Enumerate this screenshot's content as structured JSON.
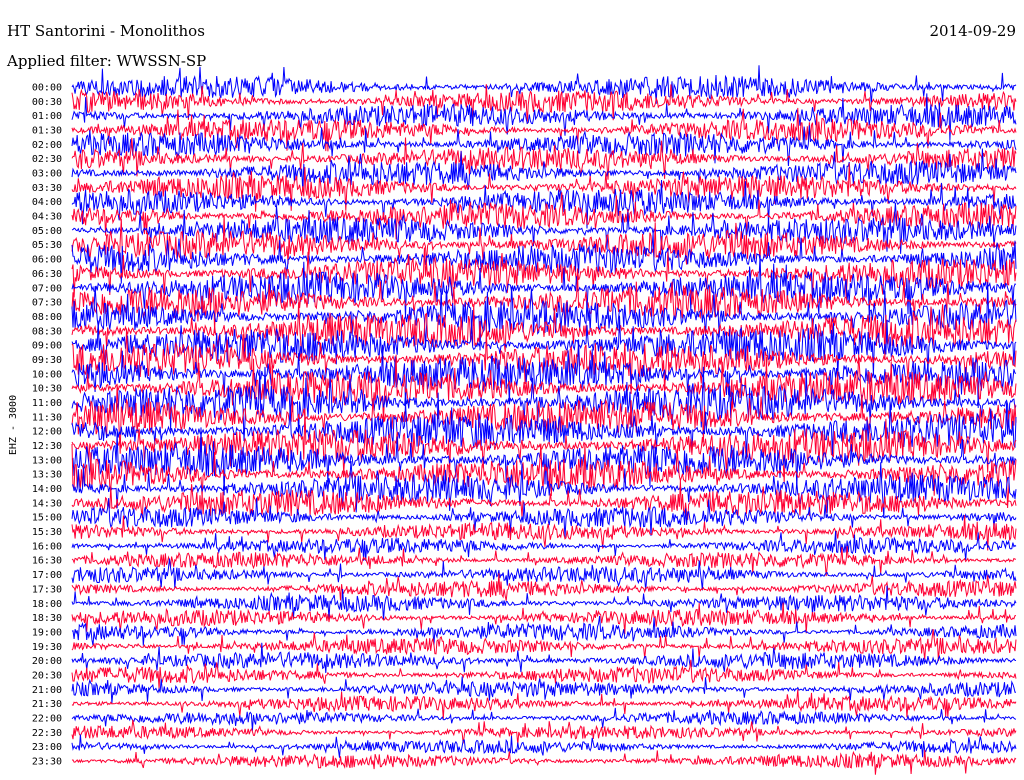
{
  "header": {
    "station_title": "HT Santorini - Monolithos",
    "date": "2014-09-29",
    "filter_text": "Applied filter: WWSSN-SP"
  },
  "chart_data": {
    "type": "helicorder",
    "title": "HT Santorini - Monolithos",
    "date": "2014-09-29",
    "filter": "WWSSN-SP",
    "ylabel": "EHZ - 3000",
    "trace_interval_minutes": 30,
    "trace_colors": [
      "#0000ff",
      "#ff0033"
    ],
    "tick_labels": [
      "00:00",
      "00:30",
      "01:00",
      "01:30",
      "02:00",
      "02:30",
      "03:00",
      "03:30",
      "04:00",
      "04:30",
      "05:00",
      "05:30",
      "06:00",
      "06:30",
      "07:00",
      "07:30",
      "08:00",
      "08:30",
      "09:00",
      "09:30",
      "10:00",
      "10:30",
      "11:00",
      "11:30",
      "12:00",
      "12:30",
      "13:00",
      "13:30",
      "14:00",
      "14:30",
      "15:00",
      "15:30",
      "16:00",
      "16:30",
      "17:00",
      "17:30",
      "18:00",
      "18:30",
      "19:00",
      "19:30",
      "20:00",
      "20:30",
      "21:00",
      "21:30",
      "22:00",
      "22:30",
      "23:00",
      "23:30"
    ],
    "relative_noise_amplitude": [
      1.25,
      1.25,
      1.3,
      1.3,
      1.35,
      1.35,
      1.4,
      1.4,
      1.45,
      1.5,
      1.55,
      1.6,
      1.7,
      1.75,
      1.8,
      1.85,
      1.9,
      1.95,
      2.0,
      2.0,
      2.0,
      2.0,
      2.0,
      2.0,
      2.0,
      1.95,
      1.9,
      1.8,
      1.6,
      1.5,
      1.2,
      1.0,
      0.9,
      0.9,
      0.95,
      0.95,
      0.95,
      0.95,
      0.95,
      0.95,
      0.95,
      0.95,
      0.9,
      0.85,
      0.75,
      0.75,
      0.75,
      0.8
    ]
  }
}
